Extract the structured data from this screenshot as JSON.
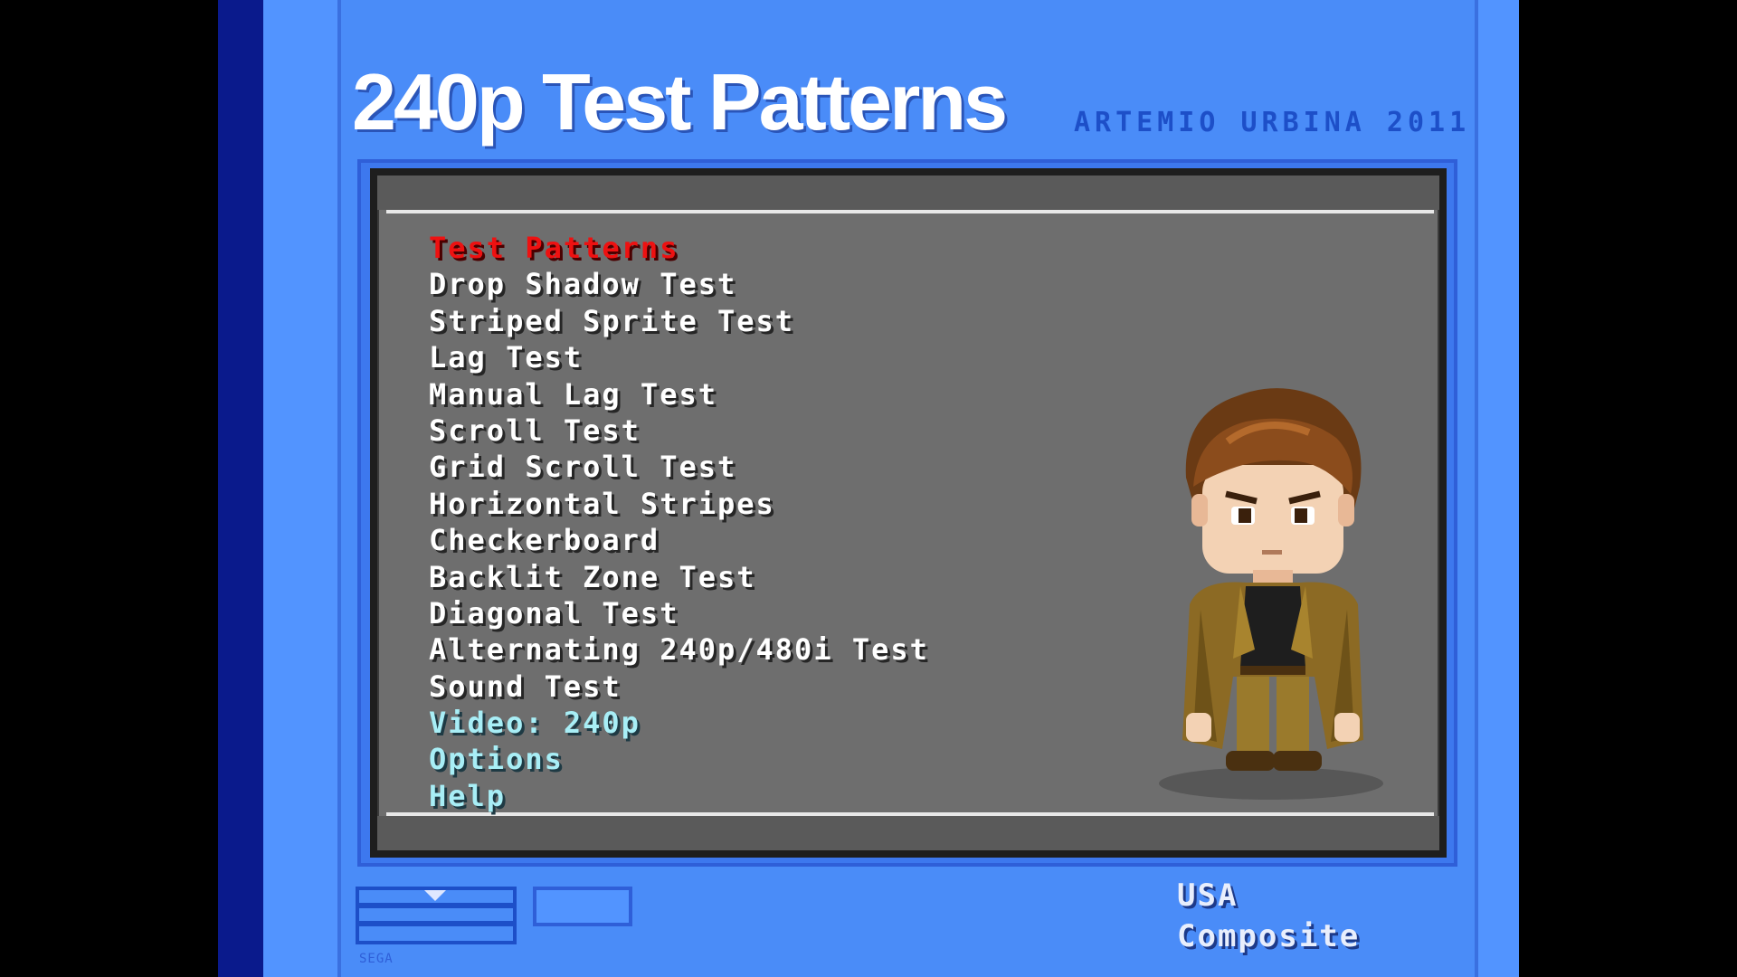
{
  "header": {
    "title": "240p Test Patterns",
    "credit": "ARTEMIO URBINA 2011"
  },
  "menu": {
    "items": [
      {
        "label": "Test Patterns",
        "selected": true
      },
      {
        "label": "Drop Shadow Test"
      },
      {
        "label": "Striped Sprite Test"
      },
      {
        "label": "Lag Test"
      },
      {
        "label": "Manual Lag Test"
      },
      {
        "label": "Scroll Test"
      },
      {
        "label": "Grid Scroll Test"
      },
      {
        "label": "Horizontal Stripes"
      },
      {
        "label": "Checkerboard"
      },
      {
        "label": "Backlit Zone Test"
      },
      {
        "label": "Diagonal Test"
      },
      {
        "label": "Alternating 240p/480i Test"
      },
      {
        "label": "Sound Test"
      },
      {
        "label": "Video: 240p"
      },
      {
        "label": "Options"
      },
      {
        "label": "Help"
      }
    ]
  },
  "footer": {
    "small_label": "SEGA",
    "region": "USA",
    "output": "Composite"
  },
  "colors": {
    "background": "#4a8cf8",
    "panel": "#6e6e6e",
    "selected": "#ee1111",
    "setting": "#a8eef6"
  },
  "character": {
    "icon": "pixel-character-portrait"
  }
}
